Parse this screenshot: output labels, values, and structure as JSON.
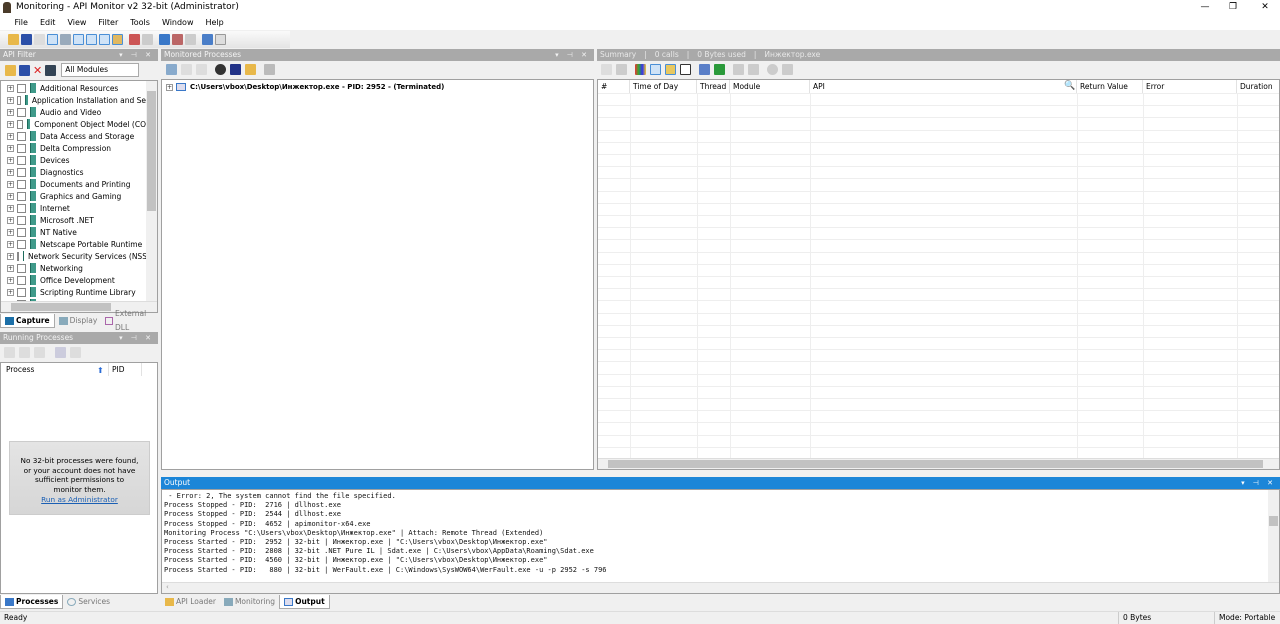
{
  "window": {
    "title": "Monitoring - API Monitor v2 32-bit (Administrator)",
    "minimize": "—",
    "maximize": "❐",
    "close": "✕"
  },
  "menu": [
    "File",
    "Edit",
    "View",
    "Filter",
    "Tools",
    "Window",
    "Help"
  ],
  "api_filter": {
    "title": "API Filter",
    "module_select": "All Modules",
    "items": [
      "Additional Resources",
      "Application Installation and Se",
      "Audio and Video",
      "Component Object Model (CO",
      "Data Access and Storage",
      "Delta Compression",
      "Devices",
      "Diagnostics",
      "Documents and Printing",
      "Graphics and Gaming",
      "Internet",
      "Microsoft .NET",
      "NT Native",
      "Netscape Portable Runtime",
      "Network Security Services (NSS",
      "Networking",
      "Office Development",
      "Scripting Runtime Library",
      "Security and Identity"
    ],
    "tabs": [
      "Capture",
      "Display",
      "External DLL"
    ]
  },
  "running_processes": {
    "title": "Running Processes",
    "columns": [
      "Process",
      "PID"
    ],
    "message": "No 32-bit processes were found, or your account does not have sufficient permissions to monitor them.",
    "link": "Run as Administrator",
    "tabs": [
      "Processes",
      "Services"
    ]
  },
  "monitored": {
    "title": "Monitored Processes",
    "process": "C:\\Users\\vbox\\Desktop\\Инжектор.exe - PID: 2952 - (Terminated)"
  },
  "summary": {
    "label": "Summary",
    "calls": "0 calls",
    "bytes": "0 Bytes used",
    "process": "Инжектор.exe",
    "columns": [
      "#",
      "Time of Day",
      "Thread",
      "Module",
      "API",
      "Return Value",
      "Error",
      "Duration"
    ]
  },
  "output": {
    "title": "Output",
    "lines": [
      " - Error: 2, The system cannot find the file specified.",
      "Process Stopped - PID:  2716 | dllhost.exe",
      "Process Stopped - PID:  2544 | dllhost.exe",
      "Process Stopped - PID:  4652 | apimonitor-x64.exe",
      "Monitoring Process \"C:\\Users\\vbox\\Desktop\\Инжектор.exe\" | Attach: Remote Thread (Extended)",
      "Process Started - PID:  2952 | 32-bit | Инжектор.exe | \"C:\\Users\\vbox\\Desktop\\Инжектор.exe\"",
      "Process Started - PID:  2808 | 32-bit .NET Pure IL | Sdat.exe | C:\\Users\\vbox\\AppData\\Roaming\\Sdat.exe",
      "Process Started - PID:  4560 | 32-bit | Инжектор.exe | \"C:\\Users\\vbox\\Desktop\\Инжектор.exe\"",
      "Process Started - PID:   880 | 32-bit | WerFault.exe | C:\\Windows\\SysWOW64\\WerFault.exe -u -p 2952 -s 796"
    ],
    "tabs": [
      "API Loader",
      "Monitoring",
      "Output"
    ]
  },
  "status": {
    "left": "Ready",
    "bytes": "0 Bytes",
    "mode": "Mode: Portable"
  },
  "colors": {
    "output_header": "#1c86d8",
    "pane_header": "#a9a9a9",
    "link": "#1a5fb4"
  }
}
